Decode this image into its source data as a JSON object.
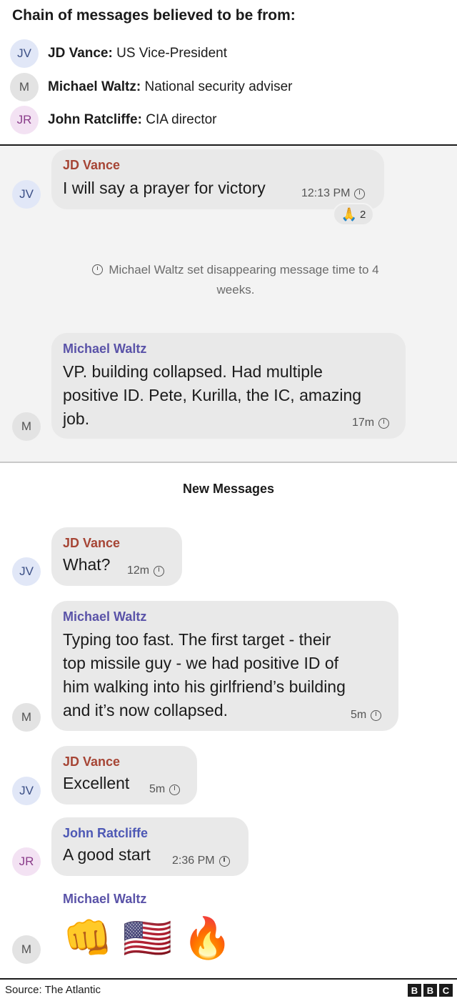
{
  "header": {
    "title": "Chain of messages believed to be from:",
    "legend": [
      {
        "initials": "JV",
        "name": "JD Vance:",
        "role": " US Vice-President"
      },
      {
        "initials": "M",
        "name": "Michael Waltz:",
        "role": " National security adviser"
      },
      {
        "initials": "JR",
        "name": "John Ratcliffe:",
        "role": " CIA director"
      }
    ]
  },
  "messages": [
    {
      "initials": "JV",
      "sender": "JD Vance",
      "text": "I will say a prayer for victory",
      "time": "12:13 PM",
      "reaction": {
        "emoji": "🙏",
        "count": "2"
      }
    },
    {
      "initials": "M",
      "sender": "Michael Waltz",
      "lines": [
        "VP.  building collapsed. Had multiple",
        "positive ID. Pete, Kurilla, the IC, amazing",
        "job."
      ],
      "time": "17m"
    },
    {
      "initials": "JV",
      "sender": "JD Vance",
      "text": "What?",
      "time": "12m"
    },
    {
      "initials": "M",
      "sender": "Michael Waltz",
      "lines": [
        "Typing too fast. The first target - their",
        "top missile guy - we had positive ID of",
        "him walking into his girlfriend’s building",
        "and it’s now collapsed."
      ],
      "time": "5m"
    },
    {
      "initials": "JV",
      "sender": "JD Vance",
      "text": "Excellent",
      "time": "5m"
    },
    {
      "initials": "JR",
      "sender": "John Ratcliffe",
      "text": "A good start",
      "time": "2:36 PM"
    },
    {
      "initials": "M",
      "sender": "Michael Waltz",
      "emojis": [
        "👊",
        "🇺🇸",
        "🔥"
      ]
    }
  ],
  "system_notice": {
    "line1": "Michael Waltz set disappearing message time to 4",
    "line2": "weeks."
  },
  "new_messages_label": "New Messages",
  "footer": {
    "source": "Source: The Atlantic",
    "logo_letters": [
      "B",
      "B",
      "C"
    ]
  }
}
